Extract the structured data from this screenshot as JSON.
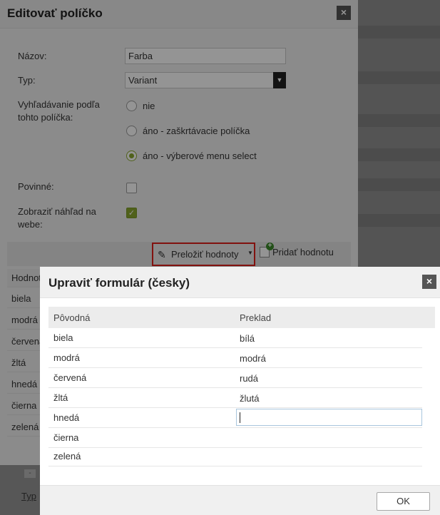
{
  "background": {
    "mini_button": "-",
    "type_link": "Typ"
  },
  "dialog1": {
    "title": "Editovať políčko",
    "close": "×",
    "name_label": "Názov:",
    "name_value": "Farba",
    "type_label": "Typ:",
    "type_value": "Variant",
    "search_label": "Vyhľadávanie podľa tohto políčka:",
    "search_options": [
      {
        "label": "nie",
        "selected": false
      },
      {
        "label": "áno - zaškrtávacie políčka",
        "selected": false
      },
      {
        "label": "áno - výberové menu select",
        "selected": true
      }
    ],
    "required_label": "Povinné:",
    "required_checked": false,
    "preview_label": "Zobraziť náhľad na webe:",
    "preview_checked": true,
    "translate_button": "Preložiť hodnoty",
    "add_value_button": "Pridať hodnotu",
    "list_header": "Hodnota",
    "list_items": [
      "biela",
      "modrá",
      "červená",
      "žltá",
      "hnedá",
      "čierna",
      "zelená"
    ]
  },
  "dialog2": {
    "title": "Upraviť formulár (česky)",
    "close": "×",
    "col_original": "Pôvodná",
    "col_translation": "Preklad",
    "rows": [
      {
        "original": "biela",
        "translation": "bílá"
      },
      {
        "original": "modrá",
        "translation": "modrá"
      },
      {
        "original": "červená",
        "translation": "rudá"
      },
      {
        "original": "žltá",
        "translation": "žlutá"
      },
      {
        "original": "hnedá",
        "translation": ""
      },
      {
        "original": "čierna",
        "translation": ""
      },
      {
        "original": "zelená",
        "translation": ""
      }
    ],
    "ok_button": "OK"
  },
  "colors": {
    "accent_green": "#8aa830",
    "highlight_red": "#e0201a"
  }
}
